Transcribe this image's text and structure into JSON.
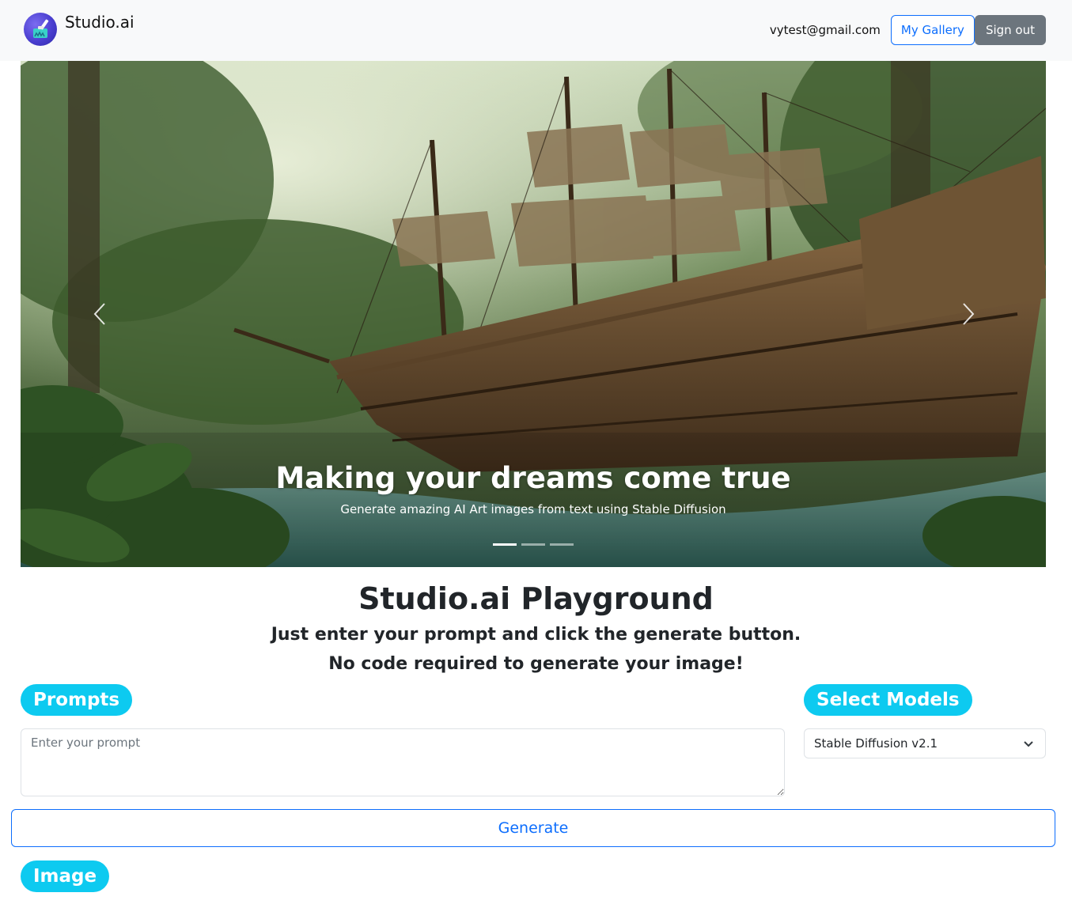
{
  "nav": {
    "brand_name": "Studio.ai",
    "logo_icon": "paint-brush-icon",
    "user_email": "vytest@gmail.com",
    "gallery_label": "My Gallery",
    "signout_label": "Sign out"
  },
  "carousel": {
    "caption_title": "Making your dreams come true",
    "caption_subtitle": "Generate amazing AI Art images from text using Stable Diffusion",
    "slide_count": 3,
    "active_slide": 1,
    "prev_icon": "chevron-left-icon",
    "next_icon": "chevron-right-icon"
  },
  "hero": {
    "title": "Studio.ai Playground",
    "line1": "Just enter your prompt and click the generate button.",
    "line2": "No code required to generate your image!"
  },
  "prompts": {
    "label": "Prompts",
    "placeholder": "Enter your prompt",
    "value": ""
  },
  "models": {
    "label": "Select Models",
    "selected": "Stable Diffusion v2.1"
  },
  "generate": {
    "label": "Generate"
  },
  "image_section": {
    "label": "Image"
  },
  "colors": {
    "primary": "#0d6efd",
    "info": "#0dcaf0",
    "secondary": "#6c757d",
    "navbar_bg": "#f8f9fa"
  }
}
